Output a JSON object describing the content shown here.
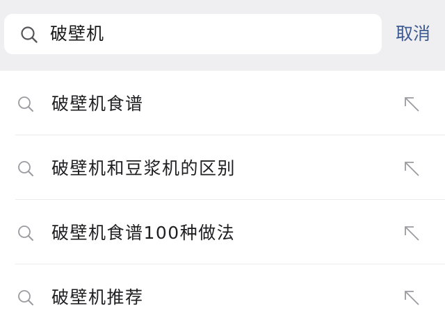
{
  "search": {
    "query": "破壁机",
    "cancel_label": "取消"
  },
  "suggestions": [
    {
      "label": "破壁机食谱"
    },
    {
      "label": "破壁机和豆浆机的区别"
    },
    {
      "label": "破壁机食谱100种做法"
    },
    {
      "label": "破壁机推荐"
    }
  ],
  "icons": {
    "search": "search-icon",
    "fill": "arrow-up-left-icon"
  },
  "colors": {
    "header_bg": "#efeff1",
    "cancel_text": "#3d5a91",
    "icon_gray": "#9a9aa0"
  }
}
